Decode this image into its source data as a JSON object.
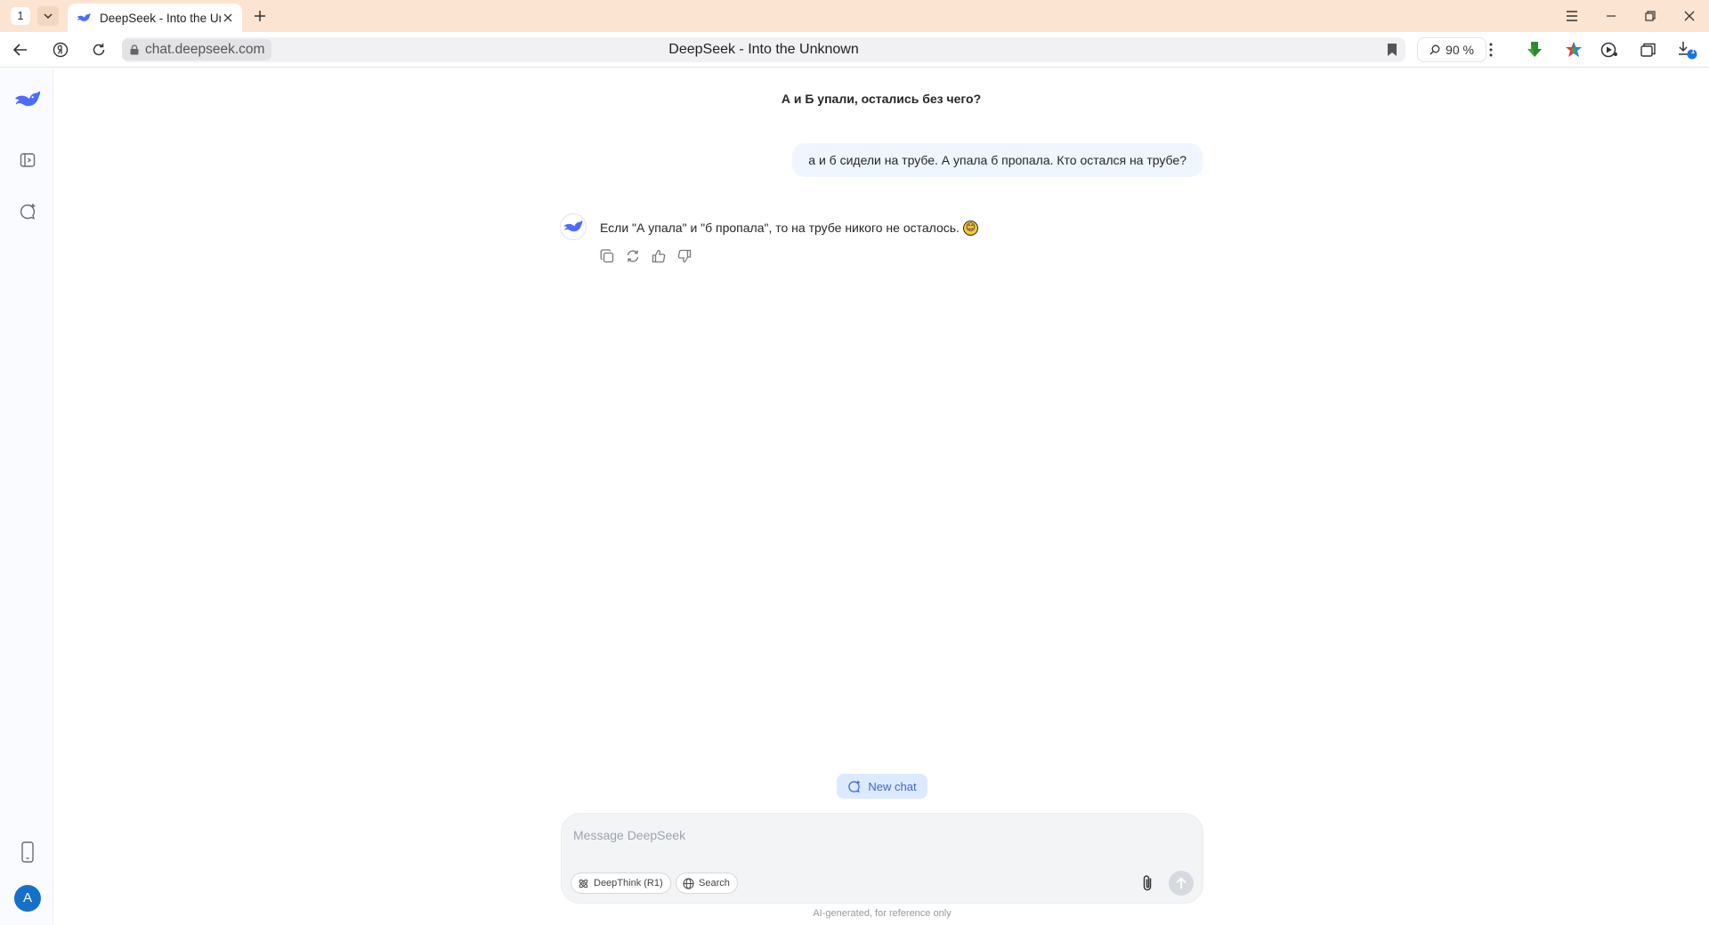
{
  "browser": {
    "tab_counter": "1",
    "tab_title": "DeepSeek - Into the Unknown",
    "url_host": "chat.deepseek.com",
    "page_title": "DeepSeek - Into the Unknown",
    "zoom": "90 %",
    "download_badge": "1"
  },
  "chat": {
    "title": "А и Б упали, остались без чего?",
    "user_message": "а и б сидели на трубе. А упала б пропала. Кто остался на трубе?",
    "assistant_message": "Если \"А упала\" и \"б пропала\", то на трубе никого не осталось.",
    "emoji": "😊"
  },
  "sidebar": {
    "avatar_initial": "A"
  },
  "composer": {
    "new_chat_label": "New chat",
    "placeholder": "Message DeepSeek",
    "deepthink_label": "DeepThink (R1)",
    "search_label": "Search",
    "disclaimer": "AI-generated, for reference only"
  },
  "colors": {
    "accent": "#4d6bfe",
    "titlebar": "#fbe4d1",
    "user_bubble": "#eff6ff",
    "avatar": "#1570c9"
  }
}
